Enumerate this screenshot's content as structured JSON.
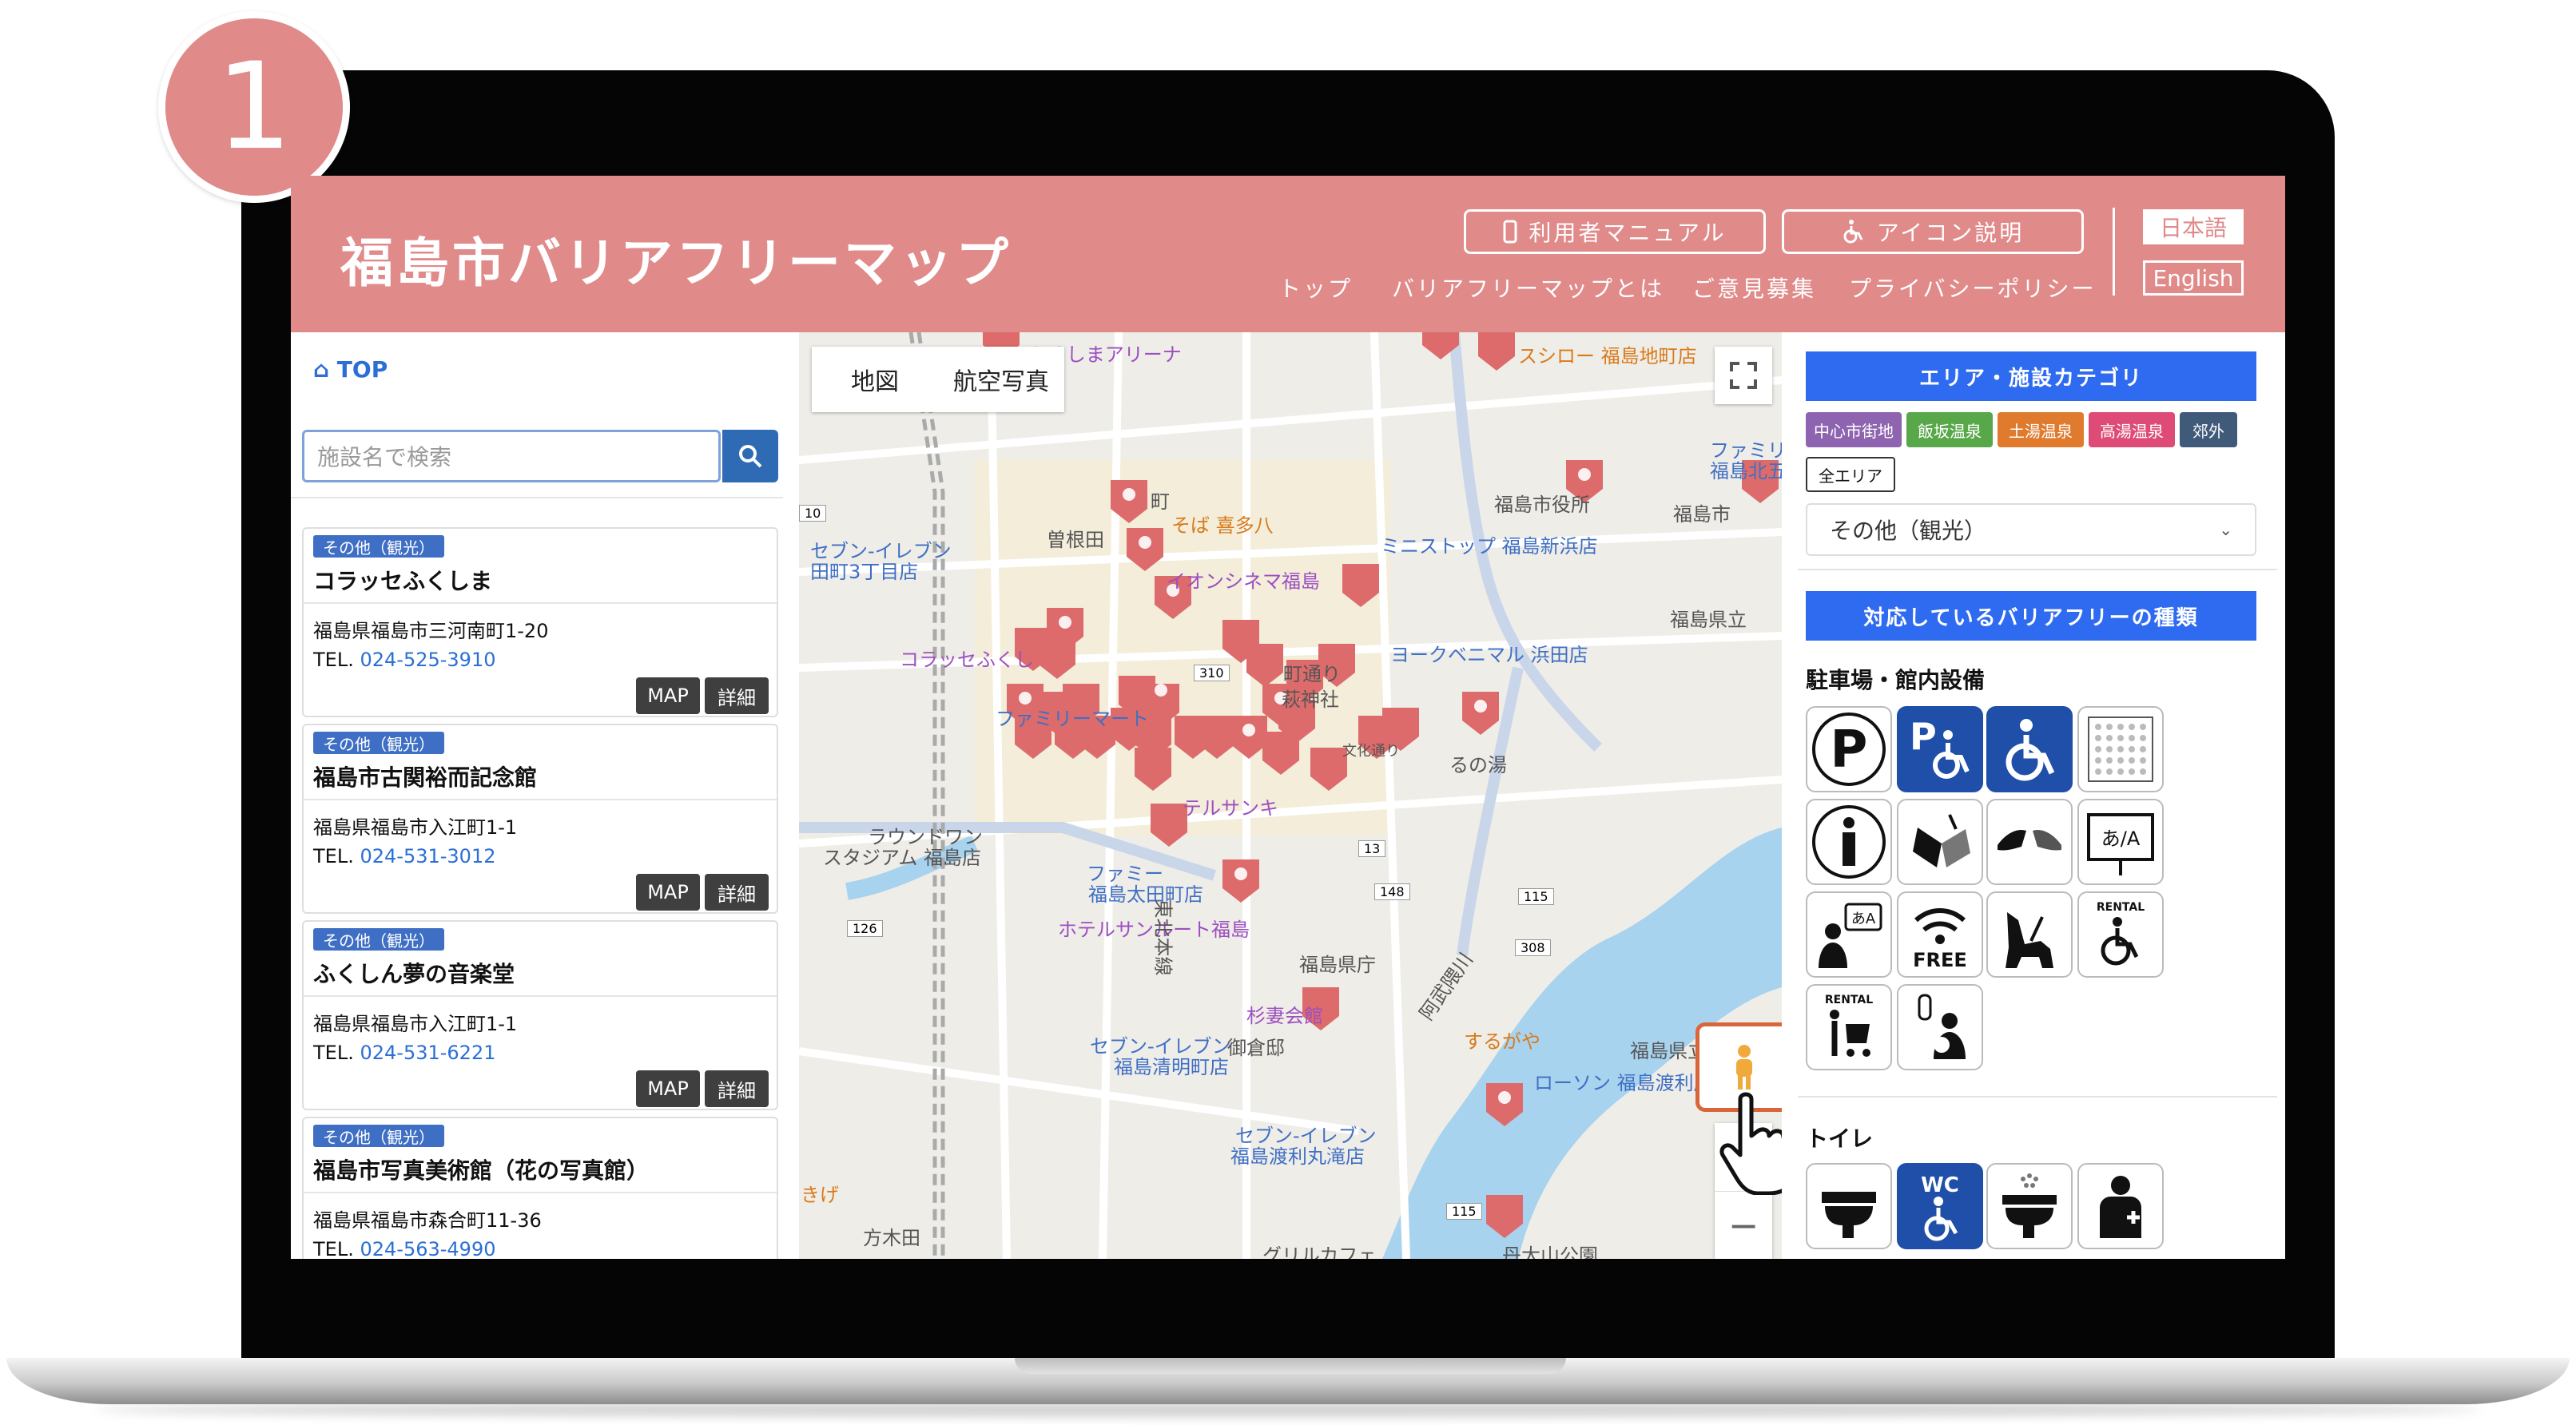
{
  "step_number": "1",
  "header": {
    "site_title": "福島市バリアフリーマップ",
    "manual_button": "利用者マニュアル",
    "icon_help_button": "アイコン説明",
    "nav": [
      "トップ",
      "バリアフリーマップとは",
      "ご意見募集",
      "プライバシーポリシー"
    ],
    "lang_ja": "日本語",
    "lang_en": "English"
  },
  "left": {
    "top_link": "TOP",
    "search_placeholder": "施設名で検索",
    "facilities": [
      {
        "category": "その他（観光）",
        "name": "コラッセふくしま",
        "address": "福島県福島市三河南町1-20",
        "tel_label": "TEL.",
        "tel": "024-525-3910",
        "map_btn": "MAP",
        "detail_btn": "詳細"
      },
      {
        "category": "その他（観光）",
        "name": "福島市古関裕而記念館",
        "address": "福島県福島市入江町1-1",
        "tel_label": "TEL.",
        "tel": "024-531-3012",
        "map_btn": "MAP",
        "detail_btn": "詳細"
      },
      {
        "category": "その他（観光）",
        "name": "ふくしん夢の音楽堂",
        "address": "福島県福島市入江町1-1",
        "tel_label": "TEL.",
        "tel": "024-531-6221",
        "map_btn": "MAP",
        "detail_btn": "詳細"
      },
      {
        "category": "その他（観光）",
        "name": "福島市写真美術館（花の写真館）",
        "address": "福島県福島市森合町11-36",
        "tel_label": "TEL.",
        "tel": "024-563-4990",
        "map_btn": "MAP",
        "detail_btn": "詳細"
      }
    ]
  },
  "map": {
    "type_map": "地図",
    "type_aerial": "航空写真",
    "labels": {
      "arena": "NCふくしまアリーナ",
      "sushiro": "スシロー 福島地町店",
      "family": "ファミリーマ",
      "family2": "福島北五老内",
      "city_office": "福島市役所",
      "soba": "そば 喜多八",
      "ministop": "ミニストップ 福島新浜店",
      "sone": "曽根田",
      "aeon": "イオンシネマ福島",
      "seven1": "セブン-イレブン",
      "seven1b": "田町3丁目店",
      "colasse": "コラッセふくし",
      "yorkbenimaru": "ヨークベニマル 浜田店",
      "prefectural": "福島県立",
      "familymart": "ファミリーマート",
      "round1": "ラウンドワン",
      "round1b": "スタジアム 福島店",
      "hotel_sunroute": "ホテルサンルート福島",
      "sakura": "テルサンキ",
      "prefoffice": "福島県庁",
      "abukuma": "阿武隈川",
      "sugitsuma": "杉妻会館",
      "surugaya": "するがや",
      "seven2": "セブン-イレブン",
      "seven2b": "福島清明町店",
      "onkeibu": "御倉邸",
      "lawson": "ローソン 福島渡利店",
      "seven3": "セブン-イレブン",
      "seven3b": "福島渡利丸滝店",
      "hotatoboku": "福島県立福島高",
      "hokuriku": "東北本線",
      "hotelfacility": "福島市",
      "hotelfacility2": "ファミー",
      "hatamachi": "方木田",
      "grill": "グリルカフェ",
      "gakudai": "丹大山公園",
      "ogi": "るの湯",
      "bunka": "文化通り",
      "rt": "町通り",
      "mm": "萩神社",
      "ohtachi": "福島太田町店",
      "yoshi": "きげ",
      "mach": "町"
    },
    "road_numbers": [
      "10",
      "310",
      "13",
      "148",
      "115",
      "308",
      "126",
      "115"
    ],
    "zoom_in": "+",
    "zoom_out": "−"
  },
  "right": {
    "area_title": "エリア・施設カテゴリ",
    "areas": [
      {
        "label": "中心市街地",
        "color": "#8e64b0"
      },
      {
        "label": "飯坂温泉",
        "color": "#58a84a"
      },
      {
        "label": "土湯温泉",
        "color": "#e07b2e"
      },
      {
        "label": "高湯温泉",
        "color": "#de4b77"
      },
      {
        "label": "郊外",
        "color": "#405a7a"
      }
    ],
    "all_area": "全エリア",
    "category_value": "その他（観光）",
    "bf_title": "対応しているバリアフリーの種類",
    "sec_parking": "駐車場・館内設備",
    "sec_toilet": "トイレ",
    "icon_texts": {
      "free": "FREE",
      "rental": "RENTAL",
      "wc": "WC",
      "kana": "あ/A"
    }
  },
  "colors": {
    "header": "#e08a8a",
    "accent_blue": "#2f6bf0",
    "pin": "#dd6b6b"
  }
}
